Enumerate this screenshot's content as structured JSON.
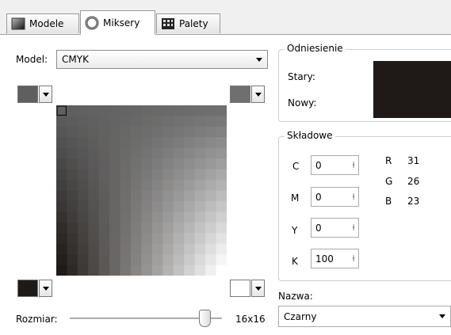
{
  "tabs": [
    {
      "label": "Modele",
      "icon": "gradient-square-icon"
    },
    {
      "label": "Miksery",
      "icon": "ring-icon"
    },
    {
      "label": "Palety",
      "icon": "palette-grid-icon"
    }
  ],
  "model": {
    "label": "Model:",
    "value": "CMYK"
  },
  "corner_colors": {
    "top_left": "#5f5f5f",
    "top_right": "#6f6f6f",
    "bottom_left": "#1f1a17",
    "bottom_right": "#ffffff"
  },
  "grid": {
    "rows": 16,
    "cols": 16
  },
  "size": {
    "label": "Rozmiar:",
    "value": "16x16",
    "slider_fraction": 0.92
  },
  "reference": {
    "title": "Odniesienie",
    "old_label": "Stary:",
    "new_label": "Nowy:",
    "swatch_color": "#1f1a17"
  },
  "components": {
    "title": "Składowe",
    "cmyk": [
      {
        "label": "C",
        "value": "0"
      },
      {
        "label": "M",
        "value": "0"
      },
      {
        "label": "Y",
        "value": "0"
      },
      {
        "label": "K",
        "value": "100"
      }
    ],
    "rgb": [
      {
        "label": "R",
        "value": "31"
      },
      {
        "label": "G",
        "value": "26"
      },
      {
        "label": "B",
        "value": "23"
      }
    ]
  },
  "name": {
    "label": "Nazwa:",
    "value": "Czarny"
  }
}
